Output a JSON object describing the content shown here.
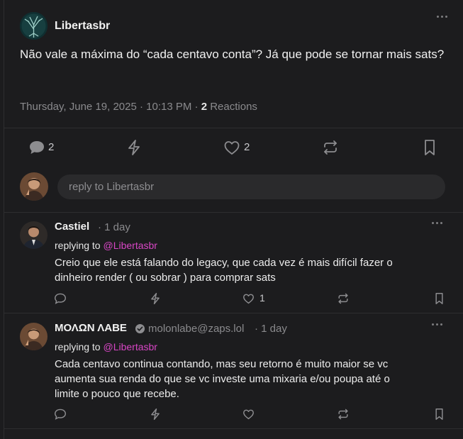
{
  "main_post": {
    "author": "Libertasbr",
    "text": "Não vale a máxima do “cada centavo conta”? Já que pode se tornar mais sats?",
    "timestamp": "Thursday, June 19, 2025 · 10:13 PM ·",
    "reactions_count": "2",
    "reactions_label": "Reactions",
    "reply_count": "2",
    "like_count": "2"
  },
  "reply_input": {
    "placeholder": "reply to Libertasbr"
  },
  "replies": [
    {
      "author": "Castiel",
      "time": "· 1 day",
      "replying_prefix": "replying to",
      "replying_mention": "@Libertasbr",
      "text_line1": "Creio que ele está falando do legacy, que cada vez é mais difícil fazer o",
      "text_line2": "dinheiro render ( ou sobrar ) para comprar sats",
      "like_count": "1"
    },
    {
      "author": "ΜΟΛΩΝ ΛΑΒΕ",
      "nip05": "molonlabe@zaps.lol",
      "time": "· 1 day",
      "replying_prefix": "replying to",
      "replying_mention": "@Libertasbr",
      "text_line1": "Cada centavo continua contando, mas seu retorno é muito maior se vc",
      "text_line2": "aumenta sua renda do que se vc investe uma mixaria e/ou poupa até o",
      "text_line3": "limite o pouco que recebe."
    }
  ],
  "colors": {
    "background": "#1c1c1e",
    "mention": "#d846c5",
    "muted": "#8a8a8d"
  }
}
